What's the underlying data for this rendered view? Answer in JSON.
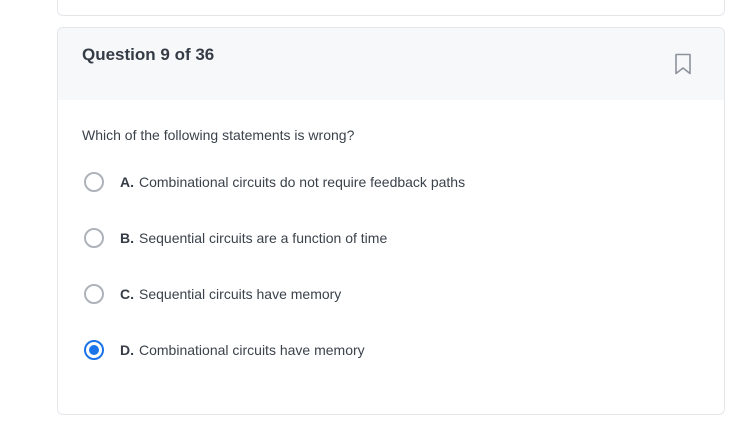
{
  "question_card": {
    "title": "Question 9 of 36",
    "bookmark_icon": "bookmark-icon",
    "prompt": "Which of the following statements is wrong?",
    "options": [
      {
        "letter": "A.",
        "text": "Combinational circuits do not require feedback paths",
        "selected": false
      },
      {
        "letter": "B.",
        "text": "Sequential circuits are a function of time",
        "selected": false
      },
      {
        "letter": "C.",
        "text": "Sequential circuits have memory",
        "selected": false
      },
      {
        "letter": "D.",
        "text": "Combinational circuits have memory",
        "selected": true
      }
    ]
  },
  "colors": {
    "accent": "#1a73e8",
    "header_bg": "#f7f8f9",
    "border": "#e4e6ea"
  }
}
